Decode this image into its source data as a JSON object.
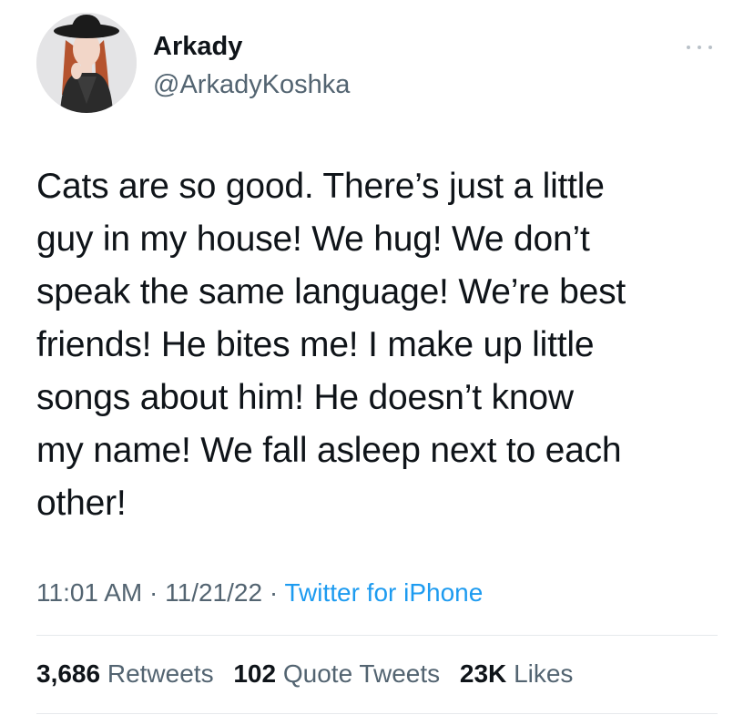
{
  "user": {
    "display_name": "Arkady",
    "handle": "@ArkadyKoshka"
  },
  "tweet": {
    "lines": [
      "Cats are so good. There’s just a little",
      "guy in my house! We hug! We don’t",
      "speak the same language! We’re best",
      "friends! He bites me! I make up little",
      "songs about him! He doesn’t know",
      "my name! We fall asleep next to each",
      "other!"
    ]
  },
  "meta": {
    "time": "11:01 AM",
    "separator": " · ",
    "date": "11/21/22",
    "source": "Twitter for iPhone"
  },
  "stats": {
    "retweets_count": "3,686",
    "retweets_label": "Retweets",
    "quotes_count": "102",
    "quotes_label": "Quote Tweets",
    "likes_count": "23K",
    "likes_label": "Likes"
  },
  "icons": {
    "more": "more-horizontal-icon"
  },
  "colors": {
    "text": "#0f1419",
    "secondary": "#536471",
    "link": "#1d9bf0",
    "divider": "#e6e9ec"
  }
}
